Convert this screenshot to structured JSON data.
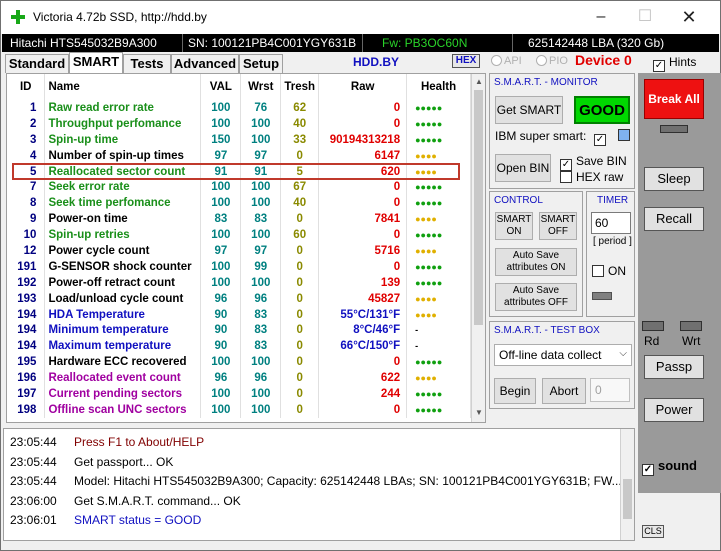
{
  "window": {
    "title": "Victoria 4.72b SSD, http://hdd.by",
    "min": "–",
    "max": "☐",
    "close": "✕"
  },
  "info": {
    "model": "Hitachi HTS545032B9A300",
    "serial": "SN: 100121PB4C001YGY631B",
    "fw": "Fw: PB3OC60N",
    "lba": "625142448 LBA (320 Gb)"
  },
  "tabs": [
    "Standard",
    "SMART",
    "Tests",
    "Advanced",
    "Setup"
  ],
  "hdd_by": "HDD.BY",
  "hex_button": "HEX",
  "api": "API",
  "pio": "PIO",
  "device": "Device 0",
  "hints": "Hints",
  "columns": [
    "ID",
    "Name",
    "VAL",
    "Wrst",
    "Tresh",
    "Raw",
    "Health"
  ],
  "colors": {
    "green": "#1a8f1a",
    "darkgreen": "#0a6a0a",
    "black": "#000000",
    "red": "#e00000",
    "blue": "#1010c0",
    "purple": "#a000a0",
    "teal": "#008080",
    "olive": "#8a8a00",
    "health_green": "#10a010",
    "health_yellow": "#e0b000"
  },
  "rows": [
    {
      "id": "1",
      "name": "Raw read error rate",
      "val": "100",
      "wrst": "76",
      "tresh": "62",
      "raw": "0",
      "health": "●●●●●",
      "name_color": "#1a8f1a",
      "raw_color": "#e00000",
      "health_color": "#10a010"
    },
    {
      "id": "2",
      "name": "Throughput perfomance",
      "val": "100",
      "wrst": "100",
      "tresh": "40",
      "raw": "0",
      "health": "●●●●●",
      "name_color": "#1a8f1a",
      "raw_color": "#e00000",
      "health_color": "#10a010"
    },
    {
      "id": "3",
      "name": "Spin-up time",
      "val": "150",
      "wrst": "100",
      "tresh": "33",
      "raw": "90194313218",
      "health": "●●●●●",
      "name_color": "#1a8f1a",
      "raw_color": "#e00000",
      "health_color": "#10a010"
    },
    {
      "id": "4",
      "name": "Number of spin-up times",
      "val": "97",
      "wrst": "97",
      "tresh": "0",
      "raw": "6147",
      "health": "●●●●",
      "name_color": "#000000",
      "raw_color": "#e00000",
      "health_color": "#e0b000"
    },
    {
      "id": "5",
      "name": "Reallocated sector count",
      "val": "91",
      "wrst": "91",
      "tresh": "5",
      "raw": "620",
      "health": "●●●●",
      "name_color": "#1a8f1a",
      "raw_color": "#e00000",
      "health_color": "#e0b000"
    },
    {
      "id": "7",
      "name": "Seek error rate",
      "val": "100",
      "wrst": "100",
      "tresh": "67",
      "raw": "0",
      "health": "●●●●●",
      "name_color": "#1a8f1a",
      "raw_color": "#e00000",
      "health_color": "#10a010"
    },
    {
      "id": "8",
      "name": "Seek time perfomance",
      "val": "100",
      "wrst": "100",
      "tresh": "40",
      "raw": "0",
      "health": "●●●●●",
      "name_color": "#1a8f1a",
      "raw_color": "#e00000",
      "health_color": "#10a010"
    },
    {
      "id": "9",
      "name": "Power-on time",
      "val": "83",
      "wrst": "83",
      "tresh": "0",
      "raw": "7841",
      "health": "●●●●",
      "name_color": "#000000",
      "raw_color": "#e00000",
      "health_color": "#e0b000"
    },
    {
      "id": "10",
      "name": "Spin-up retries",
      "val": "100",
      "wrst": "100",
      "tresh": "60",
      "raw": "0",
      "health": "●●●●●",
      "name_color": "#1a8f1a",
      "raw_color": "#e00000",
      "health_color": "#10a010"
    },
    {
      "id": "12",
      "name": "Power cycle count",
      "val": "97",
      "wrst": "97",
      "tresh": "0",
      "raw": "5716",
      "health": "●●●●",
      "name_color": "#000000",
      "raw_color": "#e00000",
      "health_color": "#e0b000"
    },
    {
      "id": "191",
      "name": "G-SENSOR shock counter",
      "val": "100",
      "wrst": "99",
      "tresh": "0",
      "raw": "0",
      "health": "●●●●●",
      "name_color": "#000000",
      "raw_color": "#e00000",
      "health_color": "#10a010"
    },
    {
      "id": "192",
      "name": "Power-off retract count",
      "val": "100",
      "wrst": "100",
      "tresh": "0",
      "raw": "139",
      "health": "●●●●●",
      "name_color": "#000000",
      "raw_color": "#e00000",
      "health_color": "#10a010"
    },
    {
      "id": "193",
      "name": "Load/unload cycle count",
      "val": "96",
      "wrst": "96",
      "tresh": "0",
      "raw": "45827",
      "health": "●●●●",
      "name_color": "#000000",
      "raw_color": "#e00000",
      "health_color": "#e0b000"
    },
    {
      "id": "194",
      "name": "HDA Temperature",
      "val": "90",
      "wrst": "83",
      "tresh": "0",
      "raw": "55°C/131°F",
      "health": "●●●●",
      "name_color": "#1010c0",
      "raw_color": "#1010c0",
      "health_color": "#e0b000"
    },
    {
      "id": "194",
      "name": "Minimum temperature",
      "val": "90",
      "wrst": "83",
      "tresh": "0",
      "raw": "8°C/46°F",
      "health": "-",
      "name_color": "#1010c0",
      "raw_color": "#1010c0",
      "health_color": "#000000"
    },
    {
      "id": "194",
      "name": "Maximum temperature",
      "val": "90",
      "wrst": "83",
      "tresh": "0",
      "raw": "66°C/150°F",
      "health": "-",
      "name_color": "#1010c0",
      "raw_color": "#1010c0",
      "health_color": "#000000"
    },
    {
      "id": "195",
      "name": "Hardware ECC recovered",
      "val": "100",
      "wrst": "100",
      "tresh": "0",
      "raw": "0",
      "health": "●●●●●",
      "name_color": "#000000",
      "raw_color": "#e00000",
      "health_color": "#10a010"
    },
    {
      "id": "196",
      "name": "Reallocated event count",
      "val": "96",
      "wrst": "96",
      "tresh": "0",
      "raw": "622",
      "health": "●●●●",
      "name_color": "#a000a0",
      "raw_color": "#e00000",
      "health_color": "#e0b000"
    },
    {
      "id": "197",
      "name": "Current pending sectors",
      "val": "100",
      "wrst": "100",
      "tresh": "0",
      "raw": "244",
      "health": "●●●●●",
      "name_color": "#a000a0",
      "raw_color": "#e00000",
      "health_color": "#10a010"
    },
    {
      "id": "198",
      "name": "Offline scan UNC sectors",
      "val": "100",
      "wrst": "100",
      "tresh": "0",
      "raw": "0",
      "health": "●●●●●",
      "name_color": "#a000a0",
      "raw_color": "#e00000",
      "health_color": "#10a010"
    }
  ],
  "monitor": {
    "title": "S.M.A.R.T. - MONITOR",
    "get_smart": "Get SMART",
    "status": "GOOD",
    "ibm": "IBM super smart:",
    "open_bin": "Open BIN",
    "save_bin": "Save BIN",
    "hex_raw": "HEX raw"
  },
  "control": {
    "title": "CONTROL",
    "smart_on": "SMART ON",
    "smart_off": "SMART OFF",
    "autosave_on": "Auto Save attributes ON",
    "autosave_off": "Auto Save attributes OFF"
  },
  "timer": {
    "title": "TIMER",
    "value": "60",
    "period": "[ period ]",
    "on": "ON"
  },
  "testbox": {
    "title": "S.M.A.R.T. - TEST BOX",
    "selected": "Off-line data collect",
    "begin": "Begin",
    "abort": "Abort",
    "lba": "0"
  },
  "right": {
    "break_all": "Break All",
    "sleep": "Sleep",
    "recall": "Recall",
    "rd": "Rd",
    "wrt": "Wrt",
    "passp": "Passp",
    "power": "Power",
    "sound": "sound",
    "cls": "CLS"
  },
  "log": [
    {
      "time": "23:05:44",
      "text": "Press F1 to About/HELP",
      "color": "#800000"
    },
    {
      "time": "23:05:44",
      "text": "Get passport... OK",
      "color": "#000000"
    },
    {
      "time": "23:05:44",
      "text": "Model: Hitachi HTS545032B9A300; Capacity: 625142448 LBAs; SN: 100121PB4C001YGY631B; FW...",
      "color": "#000000"
    },
    {
      "time": "23:06:00",
      "text": "Get S.M.A.R.T. command... OK",
      "color": "#000000"
    },
    {
      "time": "23:06:01",
      "text": "SMART status = GOOD",
      "color": "#1010c0"
    }
  ]
}
